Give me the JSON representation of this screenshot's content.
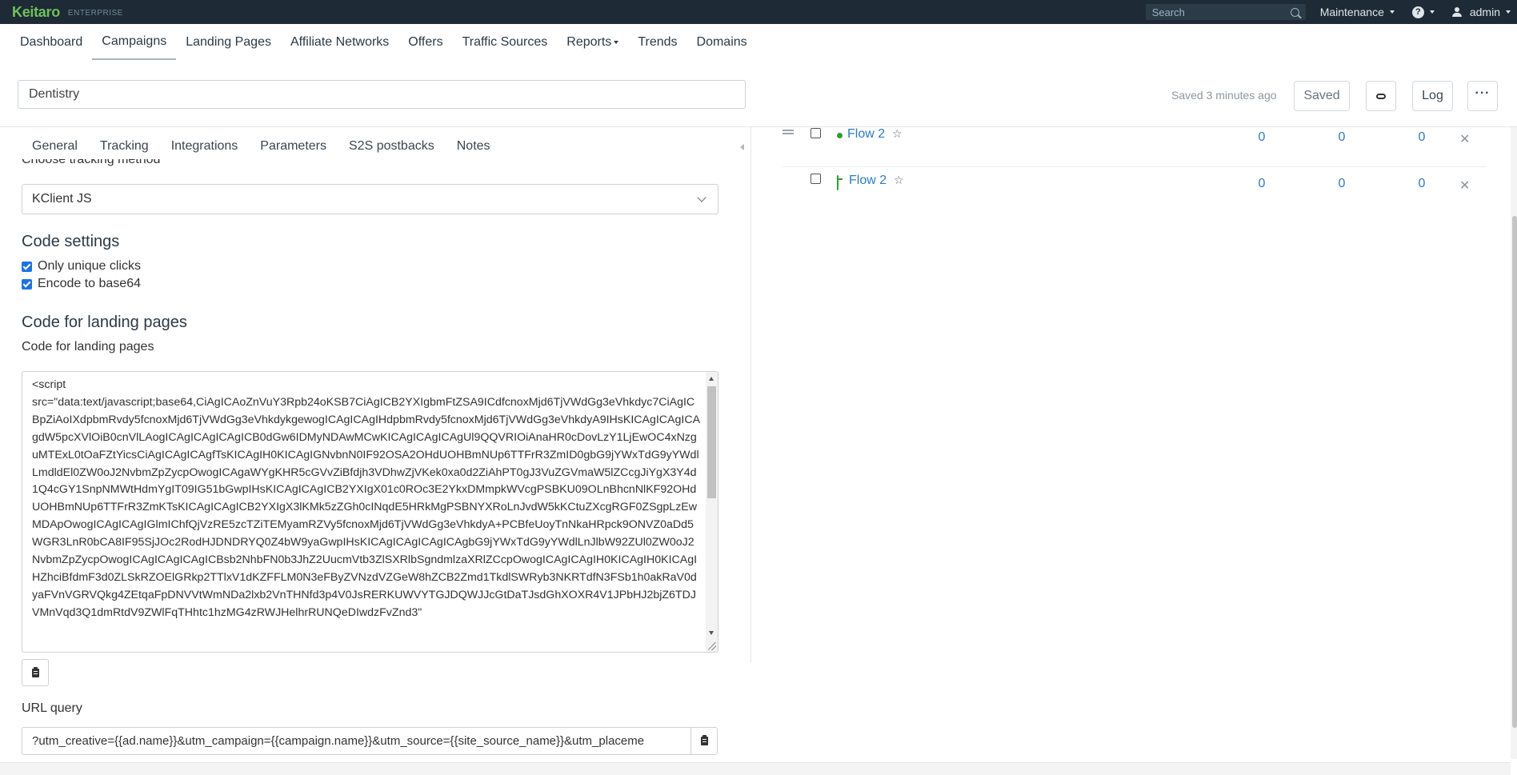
{
  "topbar": {
    "logo": "Keitaro",
    "edition": "ENTERPRISE",
    "search_placeholder": "Search",
    "maintenance": "Maintenance",
    "help": "?",
    "user": "admin"
  },
  "nav": {
    "items": [
      {
        "label": "Dashboard"
      },
      {
        "label": "Campaigns"
      },
      {
        "label": "Landing Pages"
      },
      {
        "label": "Affiliate Networks"
      },
      {
        "label": "Offers"
      },
      {
        "label": "Traffic Sources"
      },
      {
        "label": "Reports"
      },
      {
        "label": "Trends"
      },
      {
        "label": "Domains"
      }
    ]
  },
  "campaign": {
    "name": "Dentistry",
    "saved_status": "Saved 3 minutes ago",
    "saved_button": "Saved",
    "log_button": "Log"
  },
  "tabs": [
    {
      "label": "General"
    },
    {
      "label": "Tracking"
    },
    {
      "label": "Integrations"
    },
    {
      "label": "Parameters"
    },
    {
      "label": "S2S postbacks"
    },
    {
      "label": "Notes"
    }
  ],
  "tracking": {
    "method_label": "Choose tracking method",
    "method_value": "KClient JS",
    "code_settings_title": "Code settings",
    "only_unique_clicks": "Only unique clicks",
    "encode_base64": "Encode to base64",
    "code_section_title": "Code for landing pages",
    "code_field_label": "Code for landing pages",
    "code": "<script\nsrc=\"data:text/javascript;base64,CiAgICAoZnVuY3Rpb24oKSB7CiAgICB2YXIgbmFtZSA9ICdfcnoxMjd6TjVWdGg3eVhkdyc7CiAgICBpZiAoIXdpbmRvdy5fcnoxMjd6TjVWdGg3eVhkdykgewogICAgICAgIHdpbmRvdy5fcnoxMjd6TjVWdGg3eVhkdyA9IHsKICAgICAgICAgdW5pcXVlOiB0cnVlLAogICAgICAgICAgICB0dGw6IDMyNDAwMCwKICAgICAgICAgUl9QQVRIOiAnaHR0cDovLzY1LjEwOC4xNzguMTExL0tOaFZtYicsCiAgICAgICAgfTsKICAgIH0KICAgIGNvbnN0IF92OSA2OHdUOHBmNUp6TTFrR3ZmID0gbG9jYWxTdG9yYWdlLmdldEl0ZW0oJ2NvbmZpZycpOwogICAgaWYgKHR5cGVvZiBfdjh3VDhwZjVKek0xa0d2ZiAhPT0gJ3VuZGVmaW5lZCcgJiYgX3Y4d1Q4cGY1SnpNMWtHdmYgIT09IG51bGwpIHsKICAgICAgICB2YXIgX01c0ROc3E2YkxDMmpkWVcgPSBKU09OLnBhcnNlKF92OHdUOHBmNUp6TTFrR3ZmKTsKICAgICAgICB2YXIgX3lKMk5zZGh0cINqdE5HRkMgPSBNYXRoLnJvdW5kKCtuZXcgRGF0ZSgpLzEwMDApOwogICAgICAgIGlmIChfQjVzRE5zcTZiTEMyamRZVy5fcnoxMjd6TjVWdGg3eVhkdyA+PCBfeUoyTnNkaHRpck9ONVZ0aDd5WGR3LnR0bCA8IF95SjJOc2RodHJDNDRYQ0Z4bW9yaGwpIHsKICAgICAgICAgICAgbG9jYWxTdG9yYWdlLnJlbW92ZUl0ZW0oJ2NvbmZpZycpOwogICAgICAgICAgICBsb2NhbFN0b3JhZ2UucmVtb3ZlSXRlbSgndmlzaXRlZCcpOwogICAgICAgIH0KICAgIH0KICAgIHZhciBfdmF3d0ZLSkRZOElGRkp2TTlxV1dKZFFLM0N3eFByZVNzdVZGeW8hZCB2Zmd1TkdlSWRyb3NKRTdfN3FSb1h0akRaV0dyaFVnVGRVQkg4ZEtqaFpDNVVtWmNDa2lxb2VnTHNfd3p4V0JsRERKUWVYTGJDQWJJcGtDaTJsdGhXOXR4V1JPbHJ2bjZ6TDJVMnVqd3Q1dmRtdV9ZWlFqTHhtc1hzMG4zRWJHelhrRUNQeDIwdzFvZnd3\""
  },
  "url_query": {
    "label": "URL query",
    "value": "?utm_creative={{ad.name}}&utm_campaign={{campaign.name}}&utm_source={{site_source_name}}&utm_placeme"
  },
  "flows": [
    {
      "name": "Flow 2",
      "status_icon": "dot-green-icon",
      "clicks": "0",
      "conversions": "0",
      "revenue": "0"
    },
    {
      "name": "Flow 2",
      "status_icon": "enter-icon",
      "clicks": "0",
      "conversions": "0",
      "revenue": "0"
    }
  ],
  "colors": {
    "topbar_bg": "#1e2a35",
    "logo": "#6fc25a",
    "link": "#2c7cc8",
    "checkbox": "#1a73e8"
  }
}
